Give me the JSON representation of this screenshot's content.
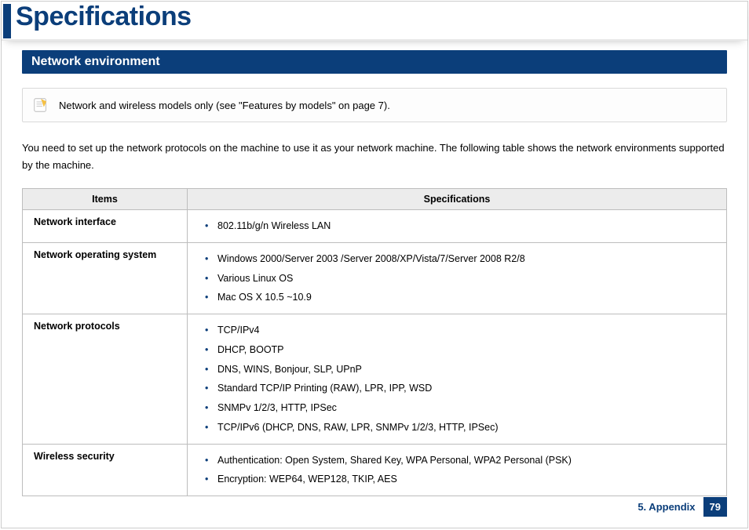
{
  "header": {
    "title": "Specifications"
  },
  "section": {
    "title": "Network environment"
  },
  "note": {
    "text": "Network and wireless models only (see \"Features by models\" on page 7)."
  },
  "intro": "You need to set up the network protocols on the machine to use it as your network machine. The following table shows the network environments supported by the machine.",
  "table": {
    "headers": {
      "col1": "Items",
      "col2": "Specifications"
    },
    "rows": [
      {
        "label": "Network interface",
        "items": [
          "802.11b/g/n Wireless LAN"
        ]
      },
      {
        "label": "Network operating system",
        "items": [
          "Windows 2000/Server 2003 /Server 2008/XP/Vista/7/Server 2008 R2/8",
          "Various Linux OS",
          "Mac OS X 10.5 ~10.9"
        ]
      },
      {
        "label": "Network protocols",
        "items": [
          "TCP/IPv4",
          "DHCP, BOOTP",
          "DNS, WINS, Bonjour, SLP, UPnP",
          "Standard TCP/IP Printing (RAW), LPR, IPP, WSD",
          "SNMPv 1/2/3, HTTP, IPSec",
          "TCP/IPv6 (DHCP, DNS, RAW, LPR, SNMPv 1/2/3, HTTP, IPSec)"
        ]
      },
      {
        "label": "Wireless security",
        "items": [
          "Authentication: Open System, Shared Key, WPA Personal, WPA2 Personal (PSK)",
          "Encryption: WEP64, WEP128, TKIP, AES"
        ]
      }
    ]
  },
  "footer": {
    "section": "5. Appendix",
    "page": "79"
  }
}
